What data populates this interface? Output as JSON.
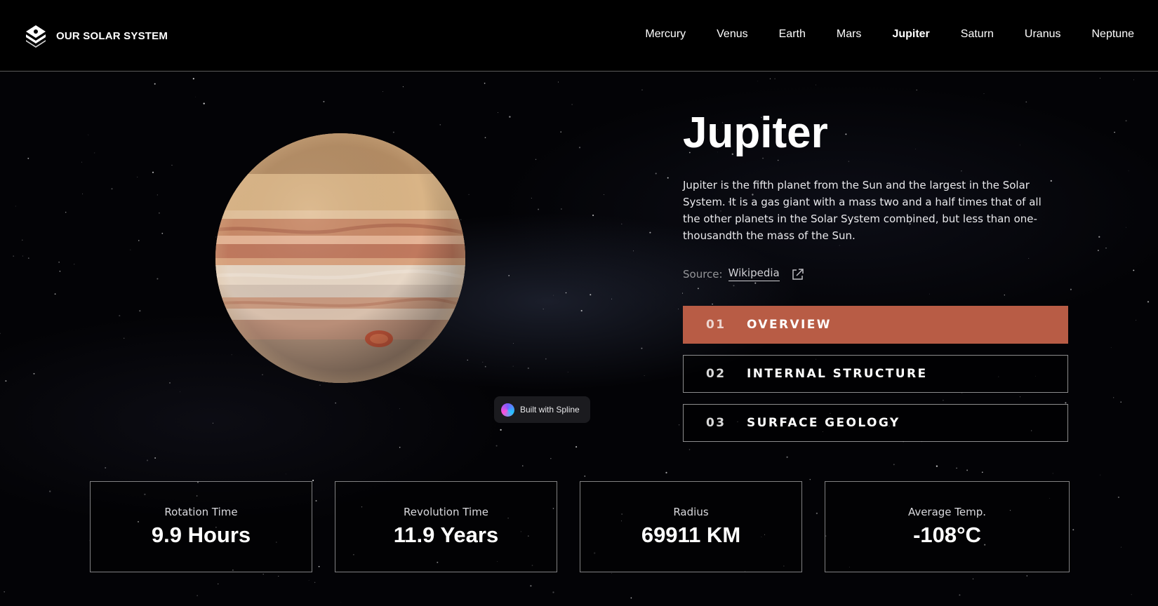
{
  "header": {
    "brand": "OUR SOLAR SYSTEM",
    "nav": [
      {
        "label": "Mercury",
        "active": false
      },
      {
        "label": "Venus",
        "active": false
      },
      {
        "label": "Earth",
        "active": false
      },
      {
        "label": "Mars",
        "active": false
      },
      {
        "label": "Jupiter",
        "active": true
      },
      {
        "label": "Saturn",
        "active": false
      },
      {
        "label": "Uranus",
        "active": false
      },
      {
        "label": "Neptune",
        "active": false
      }
    ]
  },
  "planet": {
    "name": "Jupiter",
    "description": "Jupiter is the fifth planet from the Sun and the largest in the Solar System. It is a gas giant with a mass two and a half times that of all the other planets in the Solar System combined, but less than one-thousandth the mass of the Sun.",
    "source_label": "Source:",
    "source_link": "Wikipedia",
    "badge": "Built with Spline"
  },
  "tabs": [
    {
      "num": "01",
      "label": "OVERVIEW",
      "active": true
    },
    {
      "num": "02",
      "label": "INTERNAL STRUCTURE",
      "active": false
    },
    {
      "num": "03",
      "label": "SURFACE GEOLOGY",
      "active": false
    }
  ],
  "stats": [
    {
      "label": "Rotation Time",
      "value": "9.9 Hours"
    },
    {
      "label": "Revolution Time",
      "value": "11.9 Years"
    },
    {
      "label": "Radius",
      "value": "69911 KM"
    },
    {
      "label": "Average Temp.",
      "value": "-108°C"
    }
  ],
  "colors": {
    "accent": "#b85c45",
    "background": "#030306"
  },
  "icons": {
    "logo": "solar-system-logo-icon",
    "external_link": "external-link-icon",
    "spline": "spline-logo-icon"
  }
}
